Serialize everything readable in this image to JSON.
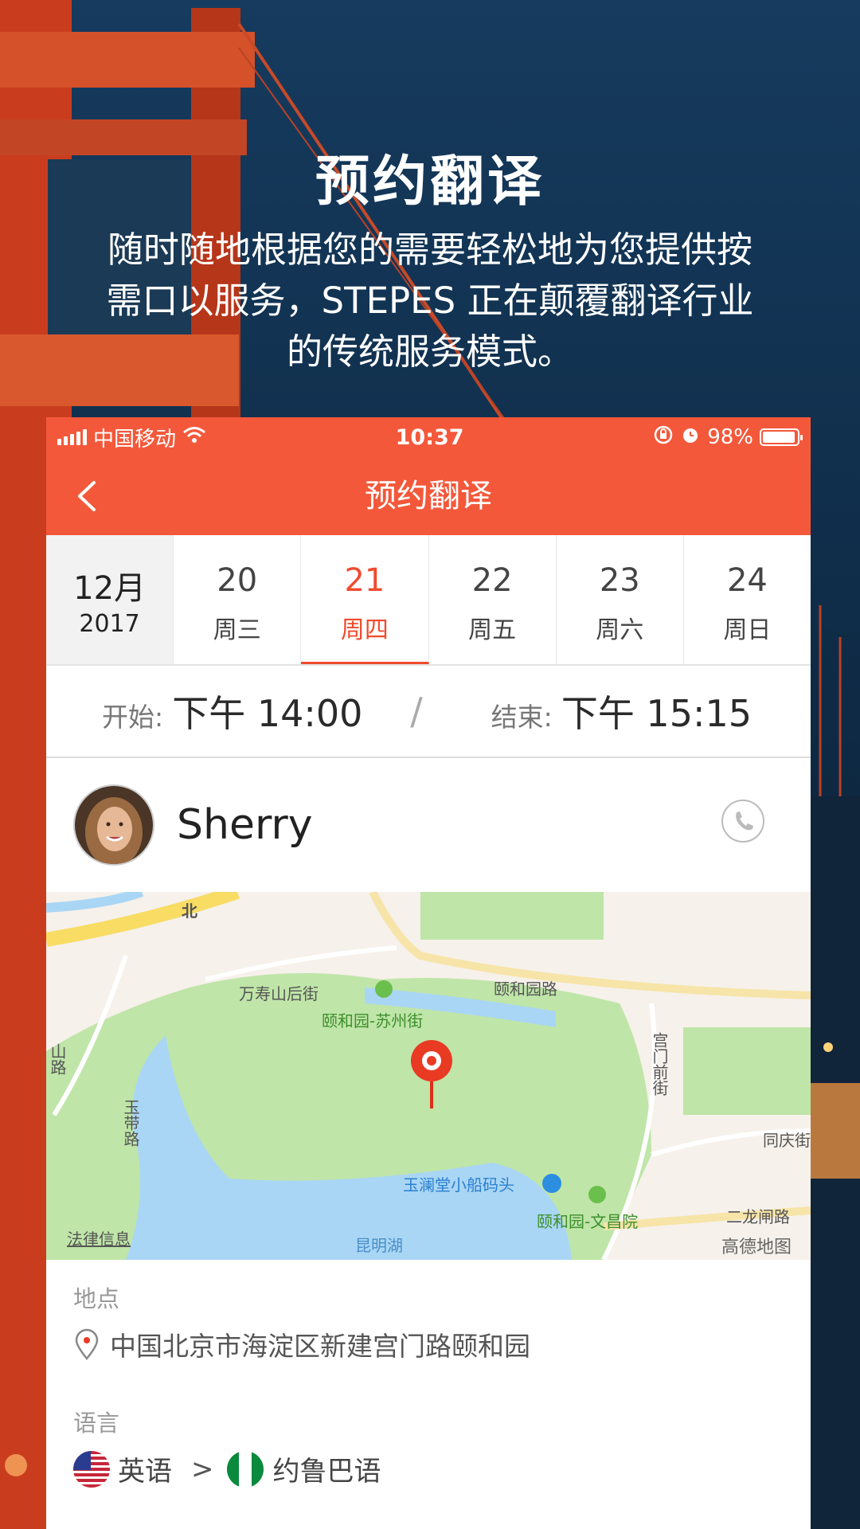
{
  "promo": {
    "title": "预约翻译",
    "description": "随时随地根据您的需要轻松地为您提供按需口以服务，STEPES 正在颠覆翻译行业的传统服务模式。"
  },
  "status_bar": {
    "carrier": "中国移动",
    "time": "10:37",
    "battery": "98%",
    "icons": [
      "signal-icon",
      "wifi-icon",
      "orientation-lock-icon",
      "alarm-icon",
      "battery-icon"
    ]
  },
  "nav": {
    "title": "预约翻译",
    "back_icon": "chevron-left-icon"
  },
  "calendar": {
    "month": "12月",
    "year": "2017",
    "days": [
      {
        "num": "20",
        "weekday": "周三",
        "selected": false
      },
      {
        "num": "21",
        "weekday": "周四",
        "selected": true
      },
      {
        "num": "22",
        "weekday": "周五",
        "selected": false
      },
      {
        "num": "23",
        "weekday": "周六",
        "selected": false
      },
      {
        "num": "24",
        "weekday": "周日",
        "selected": false
      }
    ]
  },
  "schedule": {
    "start_label": "开始:",
    "start_value": "下午 14:00",
    "separator": "/",
    "end_label": "结束:",
    "end_value": "下午 15:15"
  },
  "interpreter": {
    "name": "Sherry",
    "call_icon": "phone-icon"
  },
  "map": {
    "labels": {
      "north": "北",
      "wanshou": "万寿山后街",
      "yiheyuan_road": "颐和园路",
      "suzhou_street": "颐和园-苏州街",
      "gongmen_front": "宫门前街",
      "yulantang": "玉澜堂小船码头",
      "wenchangyuan": "颐和园-文昌院",
      "kunming_lake": "昆明湖",
      "yudai_road": "玉带路",
      "left_road": "山路",
      "tongqing": "同庆街",
      "erlong": "二龙闸路",
      "legal": "法律信息",
      "provider": "高德地图"
    }
  },
  "location": {
    "label": "地点",
    "address": "中国北京市海淀区新建宫门路颐和园"
  },
  "language": {
    "label": "语言",
    "from": "英语",
    "arrow": ">",
    "to": "约鲁巴语"
  },
  "colors": {
    "accent": "#f4583a",
    "selected": "#f04b2e",
    "park_green": "#bfe5a8",
    "lake_blue": "#a9d6f5"
  }
}
